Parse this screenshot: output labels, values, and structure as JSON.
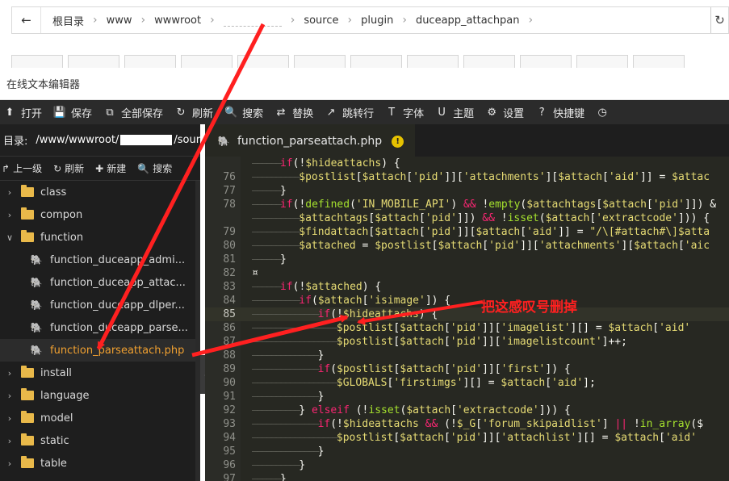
{
  "breadcrumb": {
    "back_icon": "arrow-left-icon",
    "items": [
      "根目录",
      "www",
      "wwwroot",
      "source",
      "plugin",
      "duceapp_attachpan"
    ],
    "refresh_icon": "refresh-icon"
  },
  "window": {
    "title": "在线文本编辑器"
  },
  "toolbar": {
    "items": [
      {
        "icon": "upload-icon",
        "label": "打开"
      },
      {
        "icon": "save-icon",
        "label": "保存"
      },
      {
        "icon": "save-all-icon",
        "label": "全部保存"
      },
      {
        "icon": "refresh-icon",
        "label": "刷新"
      },
      {
        "icon": "search-icon",
        "label": "搜索"
      },
      {
        "icon": "replace-icon",
        "label": "替换"
      },
      {
        "icon": "jump-icon",
        "label": "跳转行"
      },
      {
        "icon": "font-icon",
        "label": "字体"
      },
      {
        "icon": "theme-icon",
        "label": "主题"
      },
      {
        "icon": "gear-icon",
        "label": "设置"
      },
      {
        "icon": "help-icon",
        "label": "快捷键"
      },
      {
        "icon": "clock-icon",
        "label": ""
      }
    ]
  },
  "sidebar": {
    "dir_label": "目录:",
    "dir_path_start": "/www/wwwroot/",
    "dir_path_end": "/sour",
    "actions": [
      {
        "icon": "up-level-icon",
        "label": "上一级"
      },
      {
        "icon": "refresh-icon",
        "label": "刷新"
      },
      {
        "icon": "plus-icon",
        "label": "新建"
      },
      {
        "icon": "search-icon",
        "label": "搜索"
      }
    ],
    "tree": [
      {
        "type": "folder",
        "label": "class",
        "expanded": false
      },
      {
        "type": "folder",
        "label": "compon",
        "expanded": false
      },
      {
        "type": "folder",
        "label": "function",
        "expanded": true
      },
      {
        "type": "file",
        "label": "function_duceapp_admi...",
        "active": false
      },
      {
        "type": "file",
        "label": "function_duceapp_attac...",
        "active": false
      },
      {
        "type": "file",
        "label": "function_duceapp_dlper...",
        "active": false
      },
      {
        "type": "file",
        "label": "function_duceapp_parse...",
        "active": false
      },
      {
        "type": "file",
        "label": "function_parseattach.php",
        "active": true
      },
      {
        "type": "folder",
        "label": "install",
        "expanded": false
      },
      {
        "type": "folder",
        "label": "language",
        "expanded": false
      },
      {
        "type": "folder",
        "label": "model",
        "expanded": false
      },
      {
        "type": "folder",
        "label": "static",
        "expanded": false
      },
      {
        "type": "folder",
        "label": "table",
        "expanded": false
      }
    ]
  },
  "editor": {
    "tab": {
      "label": "function_parseattach.php",
      "warn": "!"
    },
    "colors": {
      "keyword": "#f92672",
      "variable": "#e6db74",
      "string": "#e6db74",
      "function": "#a6e22e",
      "plain": "#f8f8f2",
      "guide": "#5a5b53"
    },
    "lines": [
      {
        "n": "",
        "segs": [
          [
            "guide",
            "——————"
          ],
          [
            "kw",
            "if"
          ],
          [
            "p",
            "(!"
          ],
          [
            "var",
            "$hideattachs"
          ],
          [
            "p",
            ") {"
          ]
        ]
      },
      {
        "n": "76",
        "segs": [
          [
            "guide",
            "——————————"
          ],
          [
            "var",
            "$postlist"
          ],
          [
            "p",
            "["
          ],
          [
            "var",
            "$attach"
          ],
          [
            "p",
            "["
          ],
          [
            "str",
            "'pid'"
          ],
          [
            "p",
            "]]["
          ],
          [
            "str",
            "'attachments'"
          ],
          [
            "p",
            "]["
          ],
          [
            "var",
            "$attach"
          ],
          [
            "p",
            "["
          ],
          [
            "str",
            "'aid'"
          ],
          [
            "p",
            "]] = "
          ],
          [
            "var",
            "$attac"
          ]
        ]
      },
      {
        "n": "77",
        "segs": [
          [
            "guide",
            "——————"
          ],
          [
            "p",
            "}"
          ]
        ]
      },
      {
        "n": "78",
        "segs": [
          [
            "guide",
            "——————"
          ],
          [
            "kw",
            "if"
          ],
          [
            "p",
            "(!"
          ],
          [
            "fn",
            "defined"
          ],
          [
            "p",
            "("
          ],
          [
            "str",
            "'IN_MOBILE_API'"
          ],
          [
            "p",
            ") "
          ],
          [
            "kw",
            "&&"
          ],
          [
            "p",
            " !"
          ],
          [
            "fn",
            "empty"
          ],
          [
            "p",
            "("
          ],
          [
            "var",
            "$attachtags"
          ],
          [
            "p",
            "["
          ],
          [
            "var",
            "$attach"
          ],
          [
            "p",
            "["
          ],
          [
            "str",
            "'pid'"
          ],
          [
            "p",
            "]]) &"
          ]
        ]
      },
      {
        "n": "",
        "segs": [
          [
            "guide",
            "——————————"
          ],
          [
            "var",
            "$attachtags"
          ],
          [
            "p",
            "["
          ],
          [
            "var",
            "$attach"
          ],
          [
            "p",
            "["
          ],
          [
            "str",
            "'pid'"
          ],
          [
            "p",
            "]]) "
          ],
          [
            "kw",
            "&&"
          ],
          [
            "p",
            " !"
          ],
          [
            "fn",
            "isset"
          ],
          [
            "p",
            "("
          ],
          [
            "var",
            "$attach"
          ],
          [
            "p",
            "["
          ],
          [
            "str",
            "'extractcode'"
          ],
          [
            "p",
            "])) {"
          ]
        ]
      },
      {
        "n": "79",
        "segs": [
          [
            "guide",
            "——————————"
          ],
          [
            "var",
            "$findattach"
          ],
          [
            "p",
            "["
          ],
          [
            "var",
            "$attach"
          ],
          [
            "p",
            "["
          ],
          [
            "str",
            "'pid'"
          ],
          [
            "p",
            "]]["
          ],
          [
            "var",
            "$attach"
          ],
          [
            "p",
            "["
          ],
          [
            "str",
            "'aid'"
          ],
          [
            "p",
            "]] = "
          ],
          [
            "str",
            "\"/\\[#attach#\\]$atta"
          ]
        ]
      },
      {
        "n": "80",
        "segs": [
          [
            "guide",
            "——————————"
          ],
          [
            "var",
            "$attached"
          ],
          [
            "p",
            " = "
          ],
          [
            "var",
            "$postlist"
          ],
          [
            "p",
            "["
          ],
          [
            "var",
            "$attach"
          ],
          [
            "p",
            "["
          ],
          [
            "str",
            "'pid'"
          ],
          [
            "p",
            "]]["
          ],
          [
            "str",
            "'attachments'"
          ],
          [
            "p",
            "]["
          ],
          [
            "var",
            "$attach"
          ],
          [
            "p",
            "["
          ],
          [
            "str",
            "'aic"
          ]
        ]
      },
      {
        "n": "81",
        "segs": [
          [
            "guide",
            "——————"
          ],
          [
            "p",
            "}"
          ]
        ]
      },
      {
        "n": "82",
        "segs": [
          [
            "p",
            "¤"
          ]
        ]
      },
      {
        "n": "83",
        "segs": [
          [
            "guide",
            "——————"
          ],
          [
            "kw",
            "if"
          ],
          [
            "p",
            "(!"
          ],
          [
            "var",
            "$attached"
          ],
          [
            "p",
            ") {"
          ]
        ]
      },
      {
        "n": "84",
        "segs": [
          [
            "guide",
            "——————————"
          ],
          [
            "kw",
            "if"
          ],
          [
            "p",
            "("
          ],
          [
            "var",
            "$attach"
          ],
          [
            "p",
            "["
          ],
          [
            "str",
            "'isimage'"
          ],
          [
            "p",
            "]) {"
          ]
        ]
      },
      {
        "n": "85",
        "hl": true,
        "segs": [
          [
            "guide",
            "——————————————"
          ],
          [
            "kw",
            "if"
          ],
          [
            "p",
            "(!"
          ],
          [
            "var",
            "$hideattachs"
          ],
          [
            "p",
            ") {"
          ]
        ]
      },
      {
        "n": "86",
        "segs": [
          [
            "guide",
            "——————————————————"
          ],
          [
            "var",
            "$postlist"
          ],
          [
            "p",
            "["
          ],
          [
            "var",
            "$attach"
          ],
          [
            "p",
            "["
          ],
          [
            "str",
            "'pid'"
          ],
          [
            "p",
            "]]["
          ],
          [
            "str",
            "'imagelist'"
          ],
          [
            "p",
            "][] = "
          ],
          [
            "var",
            "$attach"
          ],
          [
            "p",
            "["
          ],
          [
            "str",
            "'aid'"
          ]
        ]
      },
      {
        "n": "87",
        "segs": [
          [
            "guide",
            "——————————————————"
          ],
          [
            "var",
            "$postlist"
          ],
          [
            "p",
            "["
          ],
          [
            "var",
            "$attach"
          ],
          [
            "p",
            "["
          ],
          [
            "str",
            "'pid'"
          ],
          [
            "p",
            "]]["
          ],
          [
            "str",
            "'imagelistcount'"
          ],
          [
            "p",
            "]++;"
          ]
        ]
      },
      {
        "n": "88",
        "segs": [
          [
            "guide",
            "——————————————"
          ],
          [
            "p",
            "}"
          ]
        ]
      },
      {
        "n": "89",
        "segs": [
          [
            "guide",
            "——————————————"
          ],
          [
            "kw",
            "if"
          ],
          [
            "p",
            "("
          ],
          [
            "var",
            "$postlist"
          ],
          [
            "p",
            "["
          ],
          [
            "var",
            "$attach"
          ],
          [
            "p",
            "["
          ],
          [
            "str",
            "'pid'"
          ],
          [
            "p",
            "]]["
          ],
          [
            "str",
            "'first'"
          ],
          [
            "p",
            "]) {"
          ]
        ]
      },
      {
        "n": "90",
        "segs": [
          [
            "guide",
            "——————————————————"
          ],
          [
            "var",
            "$GLOBALS"
          ],
          [
            "p",
            "["
          ],
          [
            "str",
            "'firstimgs'"
          ],
          [
            "p",
            "][] = "
          ],
          [
            "var",
            "$attach"
          ],
          [
            "p",
            "["
          ],
          [
            "str",
            "'aid'"
          ],
          [
            "p",
            "];"
          ]
        ]
      },
      {
        "n": "91",
        "segs": [
          [
            "guide",
            "——————————————"
          ],
          [
            "p",
            "}"
          ]
        ]
      },
      {
        "n": "92",
        "segs": [
          [
            "guide",
            "——————————"
          ],
          [
            "p",
            "} "
          ],
          [
            "kw",
            "elseif"
          ],
          [
            "p",
            " (!"
          ],
          [
            "fn",
            "isset"
          ],
          [
            "p",
            "("
          ],
          [
            "var",
            "$attach"
          ],
          [
            "p",
            "["
          ],
          [
            "str",
            "'extractcode'"
          ],
          [
            "p",
            "])) {"
          ]
        ]
      },
      {
        "n": "93",
        "segs": [
          [
            "guide",
            "——————————————"
          ],
          [
            "kw",
            "if"
          ],
          [
            "p",
            "(!"
          ],
          [
            "var",
            "$hideattachs"
          ],
          [
            "p",
            " "
          ],
          [
            "kw",
            "&&"
          ],
          [
            "p",
            " (!"
          ],
          [
            "var",
            "$_G"
          ],
          [
            "p",
            "["
          ],
          [
            "str",
            "'forum_skipaidlist'"
          ],
          [
            "p",
            "] "
          ],
          [
            "kw",
            "||"
          ],
          [
            "p",
            " !"
          ],
          [
            "fn",
            "in_array"
          ],
          [
            "p",
            "($"
          ]
        ]
      },
      {
        "n": "94",
        "segs": [
          [
            "guide",
            "——————————————————"
          ],
          [
            "var",
            "$postlist"
          ],
          [
            "p",
            "["
          ],
          [
            "var",
            "$attach"
          ],
          [
            "p",
            "["
          ],
          [
            "str",
            "'pid'"
          ],
          [
            "p",
            "]]["
          ],
          [
            "str",
            "'attachlist'"
          ],
          [
            "p",
            "][] = "
          ],
          [
            "var",
            "$attach"
          ],
          [
            "p",
            "["
          ],
          [
            "str",
            "'aid'"
          ]
        ]
      },
      {
        "n": "95",
        "segs": [
          [
            "guide",
            "——————————————"
          ],
          [
            "p",
            "}"
          ]
        ]
      },
      {
        "n": "96",
        "segs": [
          [
            "guide",
            "——————————"
          ],
          [
            "p",
            "}"
          ]
        ]
      },
      {
        "n": "97",
        "segs": [
          [
            "guide",
            "——————"
          ],
          [
            "p",
            "}"
          ]
        ]
      }
    ]
  },
  "annotation": {
    "text": "把这感叹号删掉",
    "color": "#ff2020"
  }
}
